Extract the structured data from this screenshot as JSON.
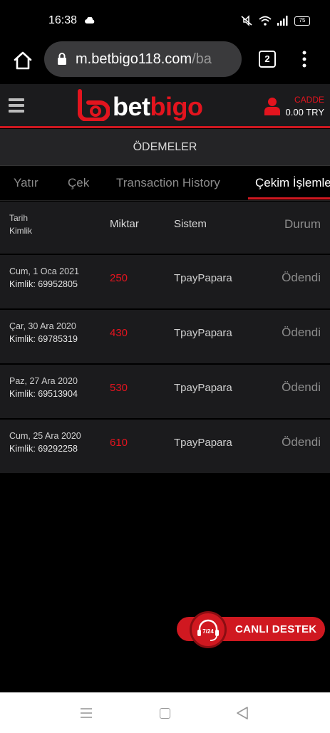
{
  "status_bar": {
    "time": "16:38",
    "battery": "75"
  },
  "browser": {
    "url_host": "m.betbigo118.com",
    "url_path": "/ba",
    "tab_count": "2"
  },
  "header": {
    "logo_bet": "bet",
    "logo_bigo": "bigo",
    "username": "CADDE",
    "balance": "0.00 TRY",
    "brand_color": "#e3141e"
  },
  "section_title": "ÖDEMELER",
  "tabs": [
    {
      "label": "Yatır"
    },
    {
      "label": "Çek"
    },
    {
      "label": "Transaction History"
    },
    {
      "label": "Çekim İşlemle"
    }
  ],
  "table": {
    "headers": {
      "date": "Tarih",
      "id": "Kimlik",
      "amount": "Miktar",
      "system": "Sistem",
      "status": "Durum"
    },
    "rows": [
      {
        "date": "Cum, 1 Oca 2021",
        "id": "Kimlik: 69952805",
        "amount": "250",
        "system": "TpayPapara",
        "status": "Ödendi"
      },
      {
        "date": "Çar, 30 Ara 2020",
        "id": "Kimlik: 69785319",
        "amount": "430",
        "system": "TpayPapara",
        "status": "Ödendi"
      },
      {
        "date": "Paz, 27 Ara 2020",
        "id": "Kimlik: 69513904",
        "amount": "530",
        "system": "TpayPapara",
        "status": "Ödendi"
      },
      {
        "date": "Cum, 25 Ara 2020",
        "id": "Kimlik: 69292258",
        "amount": "610",
        "system": "TpayPapara",
        "status": "Ödendi"
      }
    ]
  },
  "live_support": {
    "badge": "7/24",
    "label": "CANLI DESTEK"
  },
  "icons": [
    "cloud-icon",
    "mute-icon",
    "wifi-icon",
    "signal-icon",
    "battery-icon",
    "home-icon",
    "lock-icon",
    "tabs-icon",
    "more-icon",
    "menu-icon",
    "user-icon",
    "headset-icon",
    "recents-icon",
    "nav-home-icon",
    "back-icon"
  ]
}
